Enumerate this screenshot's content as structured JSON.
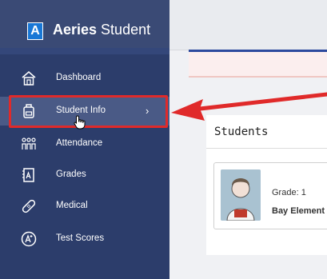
{
  "app": {
    "brand_bold": "Aeries",
    "brand_light": " Student",
    "logo_letter": "A"
  },
  "sidebar": {
    "items": [
      {
        "label": "Dashboard",
        "icon": "house-icon"
      },
      {
        "label": "Student Info",
        "icon": "backpack-icon",
        "active": true,
        "chevron": "›"
      },
      {
        "label": "Attendance",
        "icon": "people-icon"
      },
      {
        "label": "Grades",
        "icon": "grade-book-icon"
      },
      {
        "label": "Medical",
        "icon": "bandage-icon"
      },
      {
        "label": "Test Scores",
        "icon": "a-plus-icon"
      }
    ]
  },
  "main": {
    "section_title": "Students",
    "student": {
      "grade_label": "Grade:",
      "grade_value": "1",
      "school": "Bay Element"
    }
  },
  "colors": {
    "sidebar": "#2c3d6b",
    "accent": "#1877d6",
    "highlight": "#e02a2a"
  }
}
